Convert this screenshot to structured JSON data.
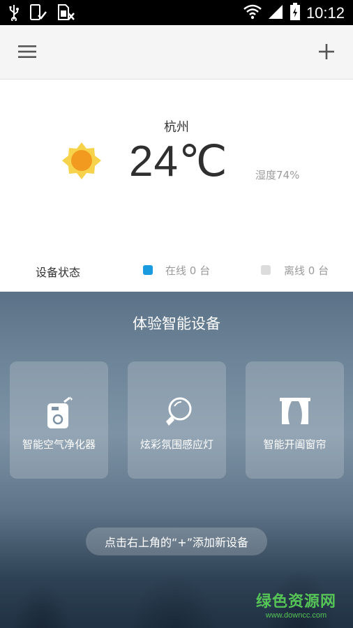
{
  "statusbar": {
    "time": "10:12",
    "icons": [
      "usb-icon",
      "phone-check-icon",
      "sim-icon",
      "wifi-icon",
      "signal-icon",
      "battery-icon"
    ]
  },
  "appbar": {
    "menu_icon": "hamburger-menu-icon",
    "add_icon": "plus-icon"
  },
  "weather": {
    "city": "杭州",
    "temperature": "24℃",
    "humidity": "湿度74%",
    "icon": "sun-icon"
  },
  "device_status": {
    "title": "设备状态",
    "online": "在线 0 台",
    "offline": "离线 0 台",
    "online_color": "#1a9be0",
    "offline_color": "#dcdcdc"
  },
  "experience": {
    "title": "体验智能设备",
    "cards": [
      {
        "label": "智能空气净化器",
        "icon": "air-purifier-icon"
      },
      {
        "label": "炫彩氛围感应灯",
        "icon": "bulb-icon"
      },
      {
        "label": "智能开阖窗帘",
        "icon": "curtain-icon"
      }
    ],
    "hint": "点击右上角的“+”添加新设备"
  },
  "watermark": {
    "line1": "绿色资源网",
    "line2": "www.downcc.com"
  }
}
